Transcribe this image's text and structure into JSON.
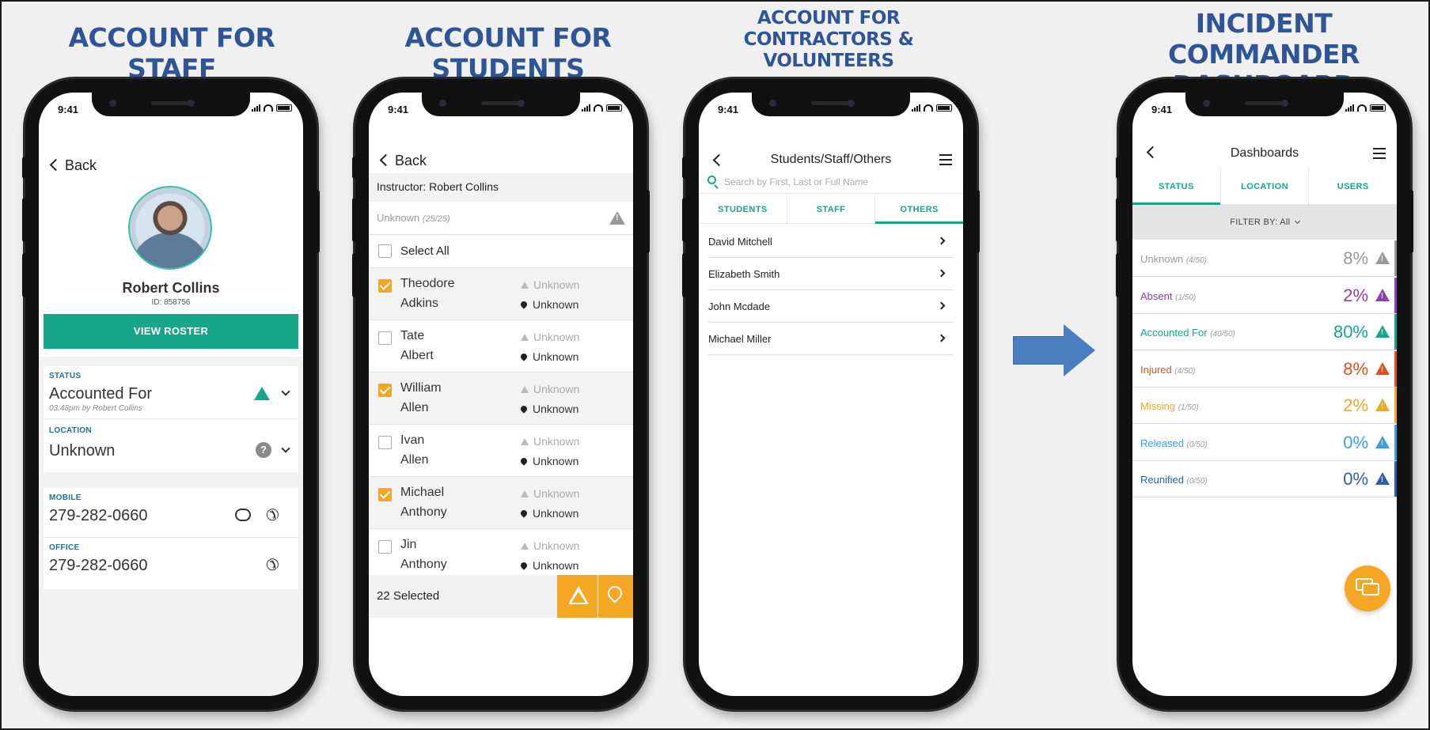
{
  "headings": {
    "staff": "ACCOUNT FOR STAFF",
    "students": "ACCOUNT FOR STUDENTS",
    "contractors_line1": "ACCOUNT FOR",
    "contractors_line2": "CONTRACTORS &",
    "contractors_line3": "VOLUNTEERS",
    "dashboard_line1": "INCIDENT COMMANDER",
    "dashboard_line2": "DASHBOARD"
  },
  "status_bar": {
    "time": "9:41"
  },
  "staff": {
    "back_label": "Back",
    "name": "Robert Collins",
    "id": "ID: 858756",
    "view_roster": "VIEW ROSTER",
    "status_label": "STATUS",
    "status_value": "Accounted For",
    "status_sub": "03:48pm by Robert Collins",
    "location_label": "LOCATION",
    "location_value": "Unknown",
    "location_icon": "?",
    "mobile_label": "MOBILE",
    "mobile_value": "279-282-0660",
    "office_label": "OFFICE",
    "office_value": "279-282-0660"
  },
  "students": {
    "back_label": "Back",
    "instructor": "Instructor: Robert Collins",
    "unknown_label": "Unknown",
    "unknown_count": "(25/25)",
    "select_all": "Select All",
    "rows": [
      {
        "first": "Theodore",
        "last": "Adkins",
        "status": "Unknown",
        "location": "Unknown",
        "checked": true
      },
      {
        "first": "Tate",
        "last": "Albert",
        "status": "Unknown",
        "location": "Unknown",
        "checked": false
      },
      {
        "first": "William",
        "last": "Allen",
        "status": "Unknown",
        "location": "Unknown",
        "checked": true
      },
      {
        "first": "Ivan",
        "last": "Allen",
        "status": "Unknown",
        "location": "Unknown",
        "checked": false
      },
      {
        "first": "Michael",
        "last": "Anthony",
        "status": "Unknown",
        "location": "Unknown",
        "checked": true
      },
      {
        "first": "Jin",
        "last": "Anthony",
        "status": "Unknown",
        "location": "Unknown",
        "checked": false
      }
    ],
    "selected": "22 Selected"
  },
  "contractors": {
    "title": "Students/Staff/Others",
    "search_placeholder": "Search by First, Last or Full Name",
    "tabs": [
      "STUDENTS",
      "STAFF",
      "OTHERS"
    ],
    "active_tab": 2,
    "people": [
      "David Mitchell",
      "Elizabeth Smith",
      "John Mcdade",
      "Michael Miller"
    ]
  },
  "dashboard": {
    "title": "Dashboards",
    "tabs": [
      "STATUS",
      "LOCATION",
      "USERS"
    ],
    "active_tab": 0,
    "filter": "FILTER BY: All",
    "rows": [
      {
        "label": "Unknown",
        "count": "(4/50)",
        "pct": "8%",
        "color": "#9a9a9a"
      },
      {
        "label": "Absent",
        "count": "(1/50)",
        "pct": "2%",
        "color": "#8e3fb0"
      },
      {
        "label": "Accounted For",
        "count": "(40/50)",
        "pct": "80%",
        "color": "#17a68a"
      },
      {
        "label": "Injured",
        "count": "(4/50)",
        "pct": "8%",
        "color": "#e0501f"
      },
      {
        "label": "Missing",
        "count": "(1/50)",
        "pct": "2%",
        "color": "#f2a81d"
      },
      {
        "label": "Released",
        "count": "(0/50)",
        "pct": "0%",
        "color": "#3a9ee4"
      },
      {
        "label": "Reunified",
        "count": "(0/50)",
        "pct": "0%",
        "color": "#2d5fa8"
      }
    ]
  },
  "colors": {
    "accent": "#17a68a",
    "orange": "#f5a623",
    "heading": "#2f5597"
  }
}
